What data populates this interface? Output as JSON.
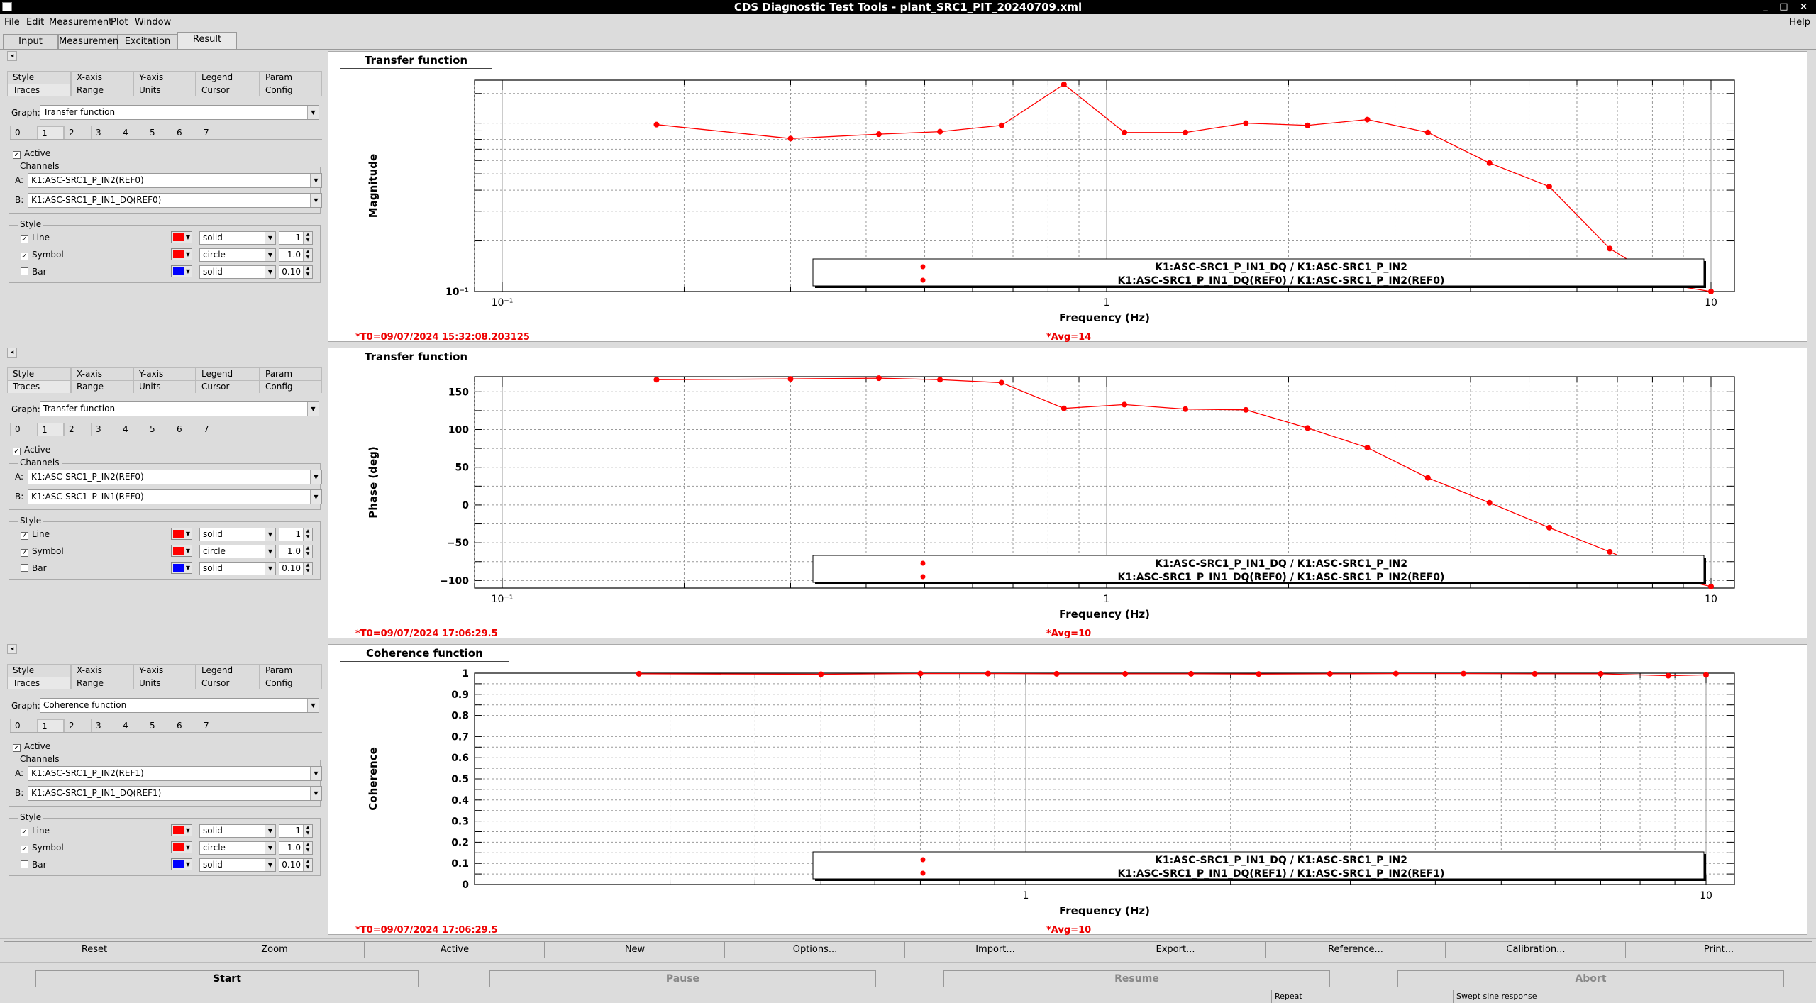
{
  "window": {
    "title": "CDS Diagnostic Test Tools - plant_SRC1_PIT_20240709.xml",
    "controls": "_ □ ×"
  },
  "menu": {
    "file": "File",
    "edit": "Edit",
    "measurement": "Measurement",
    "plot": "Plot",
    "window": "Window",
    "help": "Help"
  },
  "main_tabs": [
    {
      "label": "Input"
    },
    {
      "label": "Measurement"
    },
    {
      "label": "Excitation"
    },
    {
      "label": "Result"
    }
  ],
  "selected_main_tab": "Result",
  "panel_tabs_row1": [
    "Style",
    "X-axis",
    "Y-axis",
    "Legend",
    "Param"
  ],
  "panel_tabs_row2": [
    "Traces",
    "Range",
    "Units",
    "Cursor",
    "Config"
  ],
  "trace_tabs": [
    "0",
    "1",
    "2",
    "3",
    "4",
    "5",
    "6",
    "7"
  ],
  "labels": {
    "graph": "Graph:",
    "active": "Active",
    "channels": "Channels",
    "a": "A:",
    "b": "B:",
    "style": "Style",
    "line": "Line",
    "symbol": "Symbol",
    "bar": "Bar"
  },
  "panels": [
    {
      "graph": "Transfer function",
      "channel_a": "K1:ASC-SRC1_P_IN2(REF0)",
      "channel_b": "K1:ASC-SRC1_P_IN1_DQ(REF0)",
      "line": {
        "color": "#ff0000",
        "style": "solid",
        "width": "1"
      },
      "symbol": {
        "color": "#ff0000",
        "style": "circle",
        "size": "1.0"
      },
      "bar": {
        "color": "#0000ff",
        "style": "solid",
        "width": "0.10"
      }
    },
    {
      "graph": "Transfer function",
      "channel_a": "K1:ASC-SRC1_P_IN2(REF0)",
      "channel_b": "K1:ASC-SRC1_P_IN1(REF0)",
      "line": {
        "color": "#ff0000",
        "style": "solid",
        "width": "1"
      },
      "symbol": {
        "color": "#ff0000",
        "style": "circle",
        "size": "1.0"
      },
      "bar": {
        "color": "#0000ff",
        "style": "solid",
        "width": "0.10"
      }
    },
    {
      "graph": "Coherence function",
      "channel_a": "K1:ASC-SRC1_P_IN2(REF1)",
      "channel_b": "K1:ASC-SRC1_P_IN1_DQ(REF1)",
      "line": {
        "color": "#ff0000",
        "style": "solid",
        "width": "1"
      },
      "symbol": {
        "color": "#ff0000",
        "style": "circle",
        "size": "1.0"
      },
      "bar": {
        "color": "#0000ff",
        "style": "solid",
        "width": "0.10"
      }
    }
  ],
  "plots": [
    {
      "title": "Transfer function",
      "t0": "*T0=09/07/2024 15:32:08.203125",
      "avg": "*Avg=14"
    },
    {
      "title": "Transfer function",
      "t0": "*T0=09/07/2024 17:06:29.5",
      "avg": "*Avg=10"
    },
    {
      "title": "Coherence function",
      "t0": "*T0=09/07/2024 17:06:29.5",
      "avg": "*Avg=10"
    }
  ],
  "chart_data": [
    {
      "type": "line",
      "title": "Transfer function",
      "xlabel": "Frequency (Hz)",
      "ylabel": "Magnitude",
      "xscale": "log",
      "yscale": "log",
      "xlim": [
        0.085,
        10.5
      ],
      "ylim": [
        0.1,
        1.8
      ],
      "grid": true,
      "xticks": [
        {
          "v": 0.1,
          "label": "10⁻¹"
        },
        {
          "v": 1,
          "label": "1"
        },
        {
          "v": 10,
          "label": "10"
        }
      ],
      "yticks": [
        {
          "v": 0.1,
          "label": "10⁻¹"
        }
      ],
      "legend": {
        "placement": "bottom",
        "entries": [
          "K1:ASC-SRC1_P_IN1_DQ / K1:ASC-SRC1_P_IN2",
          "K1:ASC-SRC1_P_IN1_DQ(REF0) / K1:ASC-SRC1_P_IN2(REF0)"
        ]
      },
      "series": [
        {
          "color": "#ff0000",
          "x": [
            0.18,
            0.3,
            0.42,
            0.53,
            0.67,
            0.85,
            1.07,
            1.35,
            1.7,
            2.15,
            2.7,
            3.4,
            4.3,
            5.4,
            6.8,
            8.5,
            10
          ],
          "y": [
            0.98,
            0.81,
            0.86,
            0.89,
            0.97,
            1.7,
            0.88,
            0.88,
            1.0,
            0.97,
            1.05,
            0.88,
            0.58,
            0.42,
            0.18,
            0.11,
            0.1
          ]
        }
      ]
    },
    {
      "type": "line",
      "title": "Transfer function",
      "xlabel": "Frequency (Hz)",
      "ylabel": "Phase (deg)",
      "xscale": "log",
      "xlim": [
        0.085,
        10.5
      ],
      "ylim": [
        -110,
        170
      ],
      "grid": true,
      "xticks": [
        {
          "v": 0.1,
          "label": "10⁻¹"
        },
        {
          "v": 1,
          "label": "1"
        },
        {
          "v": 10,
          "label": "10"
        }
      ],
      "yticks": [
        {
          "v": 150,
          "label": "150"
        },
        {
          "v": 100,
          "label": "100"
        },
        {
          "v": 50,
          "label": "50"
        },
        {
          "v": 0,
          "label": "0"
        },
        {
          "v": -50,
          "label": "−50"
        },
        {
          "v": -100,
          "label": "−100"
        }
      ],
      "legend": {
        "placement": "bottom",
        "entries": [
          "K1:ASC-SRC1_P_IN1_DQ / K1:ASC-SRC1_P_IN2",
          "K1:ASC-SRC1_P_IN1_DQ(REF0) / K1:ASC-SRC1_P_IN2(REF0)"
        ]
      },
      "series": [
        {
          "color": "#ff0000",
          "x": [
            0.18,
            0.3,
            0.42,
            0.53,
            0.67,
            0.85,
            1.07,
            1.35,
            1.7,
            2.15,
            2.7,
            3.4,
            4.3,
            5.4,
            6.8,
            8.5,
            10
          ],
          "y": [
            166,
            167,
            168,
            166,
            162,
            128,
            133,
            127,
            126,
            102,
            76,
            36,
            3,
            -30,
            -62,
            -95,
            -108
          ]
        }
      ]
    },
    {
      "type": "line",
      "title": "Coherence function",
      "xlabel": "Frequency (Hz)",
      "ylabel": "Coherence",
      "xscale": "log",
      "xlim": [
        0.26,
        10.4
      ],
      "ylim": [
        0,
        1
      ],
      "grid": true,
      "xticks": [
        {
          "v": 1,
          "label": "1"
        },
        {
          "v": 10,
          "label": "10"
        }
      ],
      "yticks": [
        {
          "v": 1,
          "label": "1"
        },
        {
          "v": 0.9,
          "label": "0.9"
        },
        {
          "v": 0.8,
          "label": "0.8"
        },
        {
          "v": 0.7,
          "label": "0.7"
        },
        {
          "v": 0.6,
          "label": "0.6"
        },
        {
          "v": 0.5,
          "label": "0.5"
        },
        {
          "v": 0.4,
          "label": "0.4"
        },
        {
          "v": 0.3,
          "label": "0.3"
        },
        {
          "v": 0.2,
          "label": "0.2"
        },
        {
          "v": 0.1,
          "label": "0.1"
        },
        {
          "v": 0,
          "label": "0"
        }
      ],
      "legend": {
        "placement": "bottom",
        "entries": [
          "K1:ASC-SRC1_P_IN1_DQ / K1:ASC-SRC1_P_IN2",
          "K1:ASC-SRC1_P_IN1_DQ(REF1) / K1:ASC-SRC1_P_IN2(REF1)"
        ]
      },
      "series": [
        {
          "color": "#ff0000",
          "x": [
            0.27,
            0.5,
            0.7,
            0.88,
            1.11,
            1.4,
            1.75,
            2.2,
            2.8,
            3.5,
            4.4,
            5.6,
            7.0,
            8.8,
            10.0
          ],
          "y": [
            0.997,
            0.995,
            0.998,
            0.998,
            0.997,
            0.997,
            0.997,
            0.996,
            0.997,
            0.998,
            0.998,
            0.997,
            0.997,
            0.988,
            0.992
          ]
        }
      ]
    }
  ],
  "buttons": [
    "Reset",
    "Zoom",
    "Active",
    "New",
    "Options...",
    "Import...",
    "Export...",
    "Reference...",
    "Calibration...",
    "Print..."
  ],
  "actions": [
    "Start",
    "Pause",
    "Resume",
    "Abort"
  ],
  "status": {
    "repeat": "Repeat",
    "mode": "Swept sine response"
  }
}
